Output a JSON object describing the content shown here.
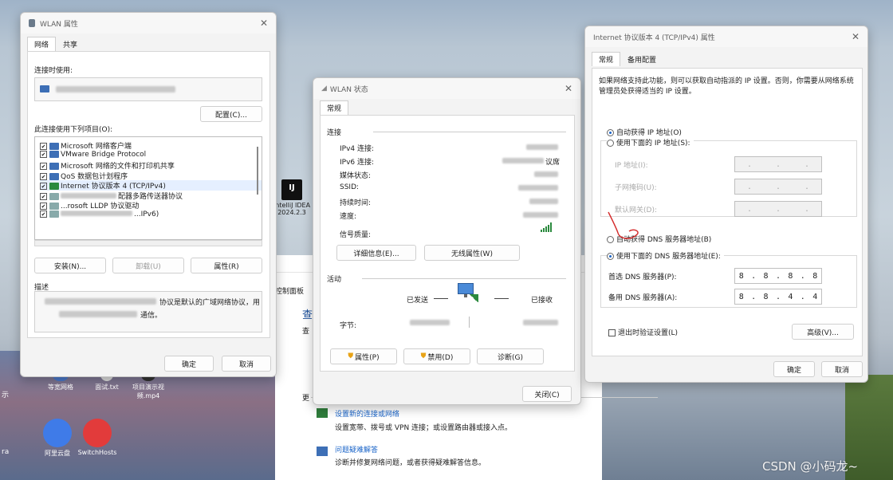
{
  "desktop": {
    "icons": [
      {
        "label": "等宽网格"
      },
      {
        "label": "面试.txt"
      },
      {
        "label": "项目演示视频.mp4"
      },
      {
        "label": "阿里云盘"
      },
      {
        "label": "SwitchHosts"
      },
      {
        "label": "IntelliJ IDEA 2024.2.3"
      }
    ],
    "left_edge_labels": [
      "示",
      "ra"
    ]
  },
  "control_panel": {
    "header_text": "控制面板",
    "heading_fragment": "查",
    "side_frag": "查",
    "more_label": "更",
    "links": [
      {
        "title": "设置新的连接或网络",
        "desc": "设置宽带、拨号或 VPN 连接；或设置路由器或接入点。"
      },
      {
        "title": "问题疑难解答",
        "desc": "诊断并修复网络问题，或者获得疑难解答信息。"
      }
    ]
  },
  "wlan_props": {
    "title": "WLAN 属性",
    "tabs": [
      "网络",
      "共享"
    ],
    "connect_using_label": "连接时使用:",
    "configure_button": "配置(C)...",
    "items_label": "此连接使用下列项目(O):",
    "items": [
      {
        "checked": true,
        "label": "Microsoft 网络客户端"
      },
      {
        "checked": true,
        "label": "VMware Bridge Protocol"
      },
      {
        "checked": true,
        "label": "Microsoft 网络的文件和打印机共享"
      },
      {
        "checked": true,
        "label": "QoS 数据包计划程序"
      },
      {
        "checked": true,
        "label": "Internet 协议版本 4 (TCP/IPv4)"
      },
      {
        "checked": true,
        "label": "配器多路传送器协议"
      },
      {
        "checked": true,
        "label": "...rosoft LLDP 协议驱动"
      },
      {
        "checked": true,
        "label": "...IPv6)"
      }
    ],
    "install_button": "安装(N)...",
    "uninstall_button": "卸载(U)",
    "properties_button": "属性(R)",
    "desc_label": "描述",
    "desc_text": "协议是默认的广域网络协议，用",
    "desc_text2": "通信。",
    "ok_button": "确定",
    "cancel_button": "取消"
  },
  "wlan_status": {
    "title": "WLAN 状态",
    "tab": "常规",
    "connection_label": "连接",
    "rows": [
      {
        "label": "IPv4 连接:"
      },
      {
        "label": "IPv6 连接:"
      },
      {
        "label": "媒体状态:"
      },
      {
        "label": "SSID:"
      },
      {
        "label": "持续时间:"
      },
      {
        "label": "速度:"
      }
    ],
    "ipv6_value_fragment": "议席",
    "signal_label": "信号质量:",
    "details_button": "详细信息(E)...",
    "wireless_button": "无线属性(W)",
    "activity_label": "活动",
    "sent_label": "已发送",
    "received_label": "已接收",
    "bytes_label": "字节:",
    "properties_button": "属性(P)",
    "disable_button": "禁用(D)",
    "diagnose_button": "诊断(G)",
    "close_button": "关闭(C)"
  },
  "ipv4": {
    "title": "Internet 协议版本 4 (TCP/IPv4) 属性",
    "tabs": [
      "常规",
      "备用配置"
    ],
    "intro": "如果网络支持此功能，则可以获取自动指派的 IP 设置。否则，你需要从网络系统管理员处获得适当的 IP 设置。",
    "auto_ip": "自动获得 IP 地址(O)",
    "manual_ip": "使用下面的 IP 地址(S):",
    "ip_label": "IP 地址(I):",
    "mask_label": "子网掩码(U):",
    "gateway_label": "默认网关(D):",
    "auto_dns": "自动获得 DNS 服务器地址(B)",
    "manual_dns": "使用下面的 DNS 服务器地址(E):",
    "preferred_dns_label": "首选 DNS 服务器(P):",
    "preferred_dns": [
      "8",
      "8",
      "8",
      "8"
    ],
    "alternate_dns_label": "备用 DNS 服务器(A):",
    "alternate_dns": [
      "8",
      "8",
      "4",
      "4"
    ],
    "validate_label": "退出时验证设置(L)",
    "advanced_button": "高级(V)...",
    "ok_button": "确定",
    "cancel_button": "取消",
    "auto_ip_selected": true,
    "manual_dns_selected": true
  },
  "watermark": "CSDN @小码龙~",
  "colors": {
    "accent": "#1a64c8",
    "annotation": "#d42a2a"
  }
}
